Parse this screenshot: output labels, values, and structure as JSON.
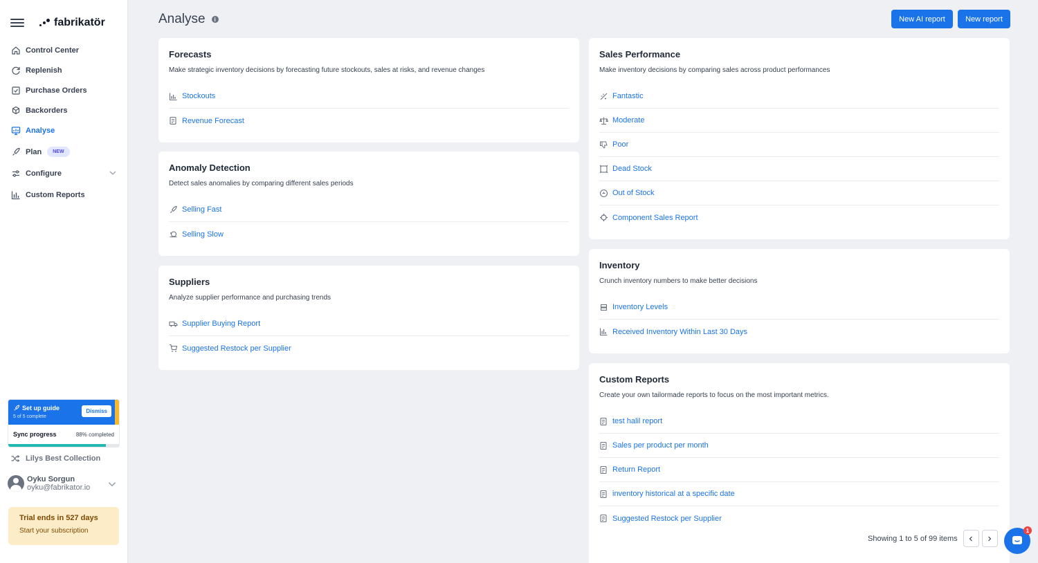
{
  "brand": {
    "name": "fabrikatör"
  },
  "sidebar": {
    "items": [
      {
        "label": "Control Center",
        "icon": "home-icon"
      },
      {
        "label": "Replenish",
        "icon": "refresh-icon"
      },
      {
        "label": "Purchase Orders",
        "icon": "checklist-icon"
      },
      {
        "label": "Backorders",
        "icon": "boxes-icon"
      },
      {
        "label": "Analyse",
        "icon": "monitor-chart-icon",
        "active": true
      },
      {
        "label": "Plan",
        "icon": "rocket-icon",
        "badge": "NEW"
      },
      {
        "label": "Configure",
        "icon": "sliders-icon"
      },
      {
        "label": "Custom Reports",
        "icon": "bar-chart-icon"
      }
    ],
    "setup_guide": {
      "title": "Set up guide",
      "subtitle": "5 of 5 complete",
      "dismiss_label": "Dismiss",
      "sync_label": "Sync progress",
      "sync_percent_text": "88% completed",
      "sync_progress": 0.88
    },
    "store": {
      "name": "Lilys Best Collection"
    },
    "user": {
      "name": "Oyku Sorgun",
      "email": "oyku@fabrikator.io"
    },
    "trial": {
      "title": "Trial ends in 527 days",
      "cta": "Start your subscription"
    }
  },
  "header": {
    "title": "Analyse",
    "new_ai_report_label": "New AI report",
    "new_report_label": "New report"
  },
  "cards": {
    "forecasts": {
      "title": "Forecasts",
      "description": "Make strategic inventory decisions by forecasting future stockouts, sales at risks, and revenue changes",
      "links": [
        {
          "label": "Stockouts",
          "icon": "chart-icon"
        },
        {
          "label": "Revenue Forecast",
          "icon": "report-icon"
        }
      ]
    },
    "anomaly": {
      "title": "Anomaly Detection",
      "description": "Detect sales anomalies by comparing different sales periods",
      "links": [
        {
          "label": "Selling Fast",
          "icon": "rocket-icon"
        },
        {
          "label": "Selling Slow",
          "icon": "snail-icon"
        }
      ]
    },
    "suppliers": {
      "title": "Suppliers",
      "description": "Analyze supplier performance and purchasing trends",
      "links": [
        {
          "label": "Supplier Buying Report",
          "icon": "truck-icon"
        },
        {
          "label": "Suggested Restock per Supplier",
          "icon": "cart-icon"
        }
      ]
    },
    "sales_performance": {
      "title": "Sales Performance",
      "description": "Make inventory decisions by comparing sales across product performances",
      "links": [
        {
          "label": "Fantastic",
          "icon": "sparkle-icon"
        },
        {
          "label": "Moderate",
          "icon": "scale-icon"
        },
        {
          "label": "Poor",
          "icon": "thumbs-down-icon"
        },
        {
          "label": "Dead Stock",
          "icon": "dead-stock-icon"
        },
        {
          "label": "Out of Stock",
          "icon": "out-of-stock-icon"
        },
        {
          "label": "Component Sales Report",
          "icon": "component-icon"
        }
      ]
    },
    "inventory": {
      "title": "Inventory",
      "description": "Crunch inventory numbers to make better decisions",
      "links": [
        {
          "label": "Inventory Levels",
          "icon": "stack-icon"
        },
        {
          "label": "Received Inventory Within Last 30 Days",
          "icon": "bar-chart-icon"
        }
      ]
    },
    "custom_reports": {
      "title": "Custom Reports",
      "description": "Create your own tailormade reports to focus on the most important metrics.",
      "links": [
        {
          "label": "test halil report",
          "icon": "report-icon"
        },
        {
          "label": "Sales per product per month",
          "icon": "report-icon"
        },
        {
          "label": "Return Report",
          "icon": "report-icon"
        },
        {
          "label": "inventory historical at a specific date",
          "icon": "report-icon"
        },
        {
          "label": "Suggested Restock per Supplier",
          "icon": "report-icon"
        }
      ],
      "pagination_text": "Showing 1 to 5 of 99 items"
    }
  },
  "chat": {
    "unread": "1"
  }
}
